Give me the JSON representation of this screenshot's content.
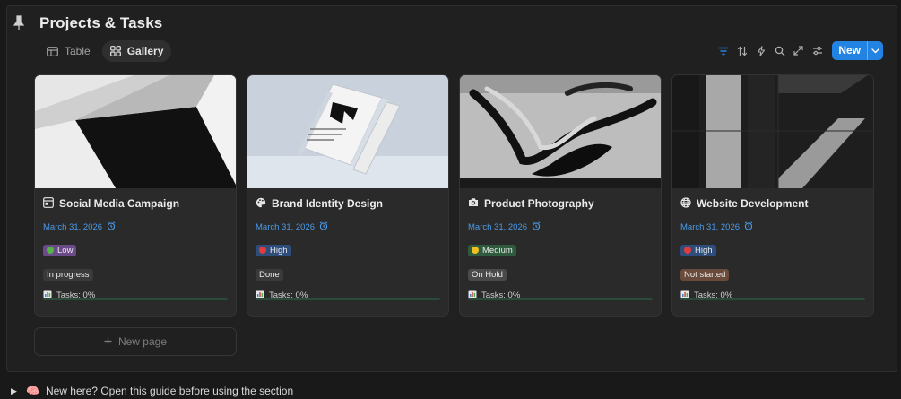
{
  "page": {
    "title": "Projects & Tasks",
    "icon": "pushpin-icon"
  },
  "views": [
    {
      "label": "Table",
      "icon": "table-icon",
      "active": false
    },
    {
      "label": "Gallery",
      "icon": "gallery-icon",
      "active": true
    }
  ],
  "toolbar": {
    "icons": [
      "filter-icon",
      "sort-icon",
      "automation-icon",
      "search-icon",
      "expand-icon",
      "settings-icon"
    ],
    "new_label": "New",
    "accent": "#2383e2"
  },
  "cards": [
    {
      "title": "Social Media Campaign",
      "icon": "media-icon",
      "date": "March 31, 2026",
      "priority": {
        "label": "Low",
        "bg": "#6b4a8a",
        "dot": "#54b446"
      },
      "status": {
        "label": "In progress",
        "bg": "#3a3a3a"
      },
      "tasks": "Tasks: 0%",
      "progress": 0
    },
    {
      "title": "Brand Identity Design",
      "icon": "palette-icon",
      "date": "March 31, 2026",
      "priority": {
        "label": "High",
        "bg": "#2e4d7a",
        "dot": "#e03c3c"
      },
      "status": {
        "label": "Done",
        "bg": "#3a3a3a"
      },
      "tasks": "Tasks: 0%",
      "progress": 0
    },
    {
      "title": "Product Photography",
      "icon": "camera-icon",
      "date": "March 31, 2026",
      "priority": {
        "label": "Medium",
        "bg": "#2f5a3e",
        "dot": "#f0c020"
      },
      "status": {
        "label": "On Hold",
        "bg": "#4a4a4a"
      },
      "tasks": "Tasks: 0%",
      "progress": 0
    },
    {
      "title": "Website Development",
      "icon": "globe-icon",
      "date": "March 31, 2026",
      "priority": {
        "label": "High",
        "bg": "#2e4d7a",
        "dot": "#e03c3c"
      },
      "status": {
        "label": "Not started",
        "bg": "#6a4a3a"
      },
      "tasks": "Tasks: 0%",
      "progress": 0
    }
  ],
  "new_page_label": "New page",
  "guide": {
    "emoji": "🧠",
    "text": "New here? Open this guide before using the section"
  }
}
